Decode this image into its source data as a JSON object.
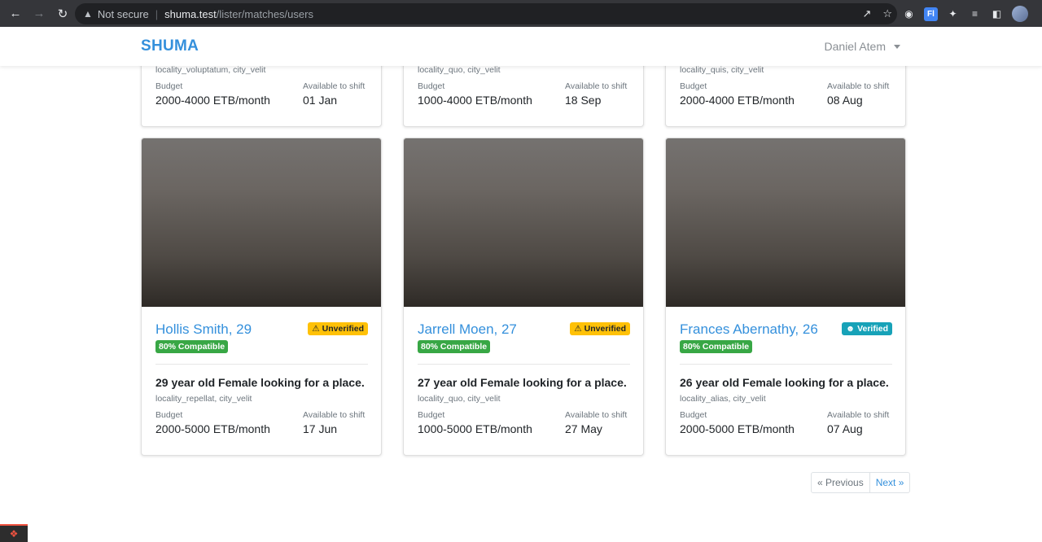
{
  "browser": {
    "security_label": "Not secure",
    "url_host": "shuma.test",
    "url_path": "/lister/matches/users"
  },
  "app": {
    "brand": "SHUMA",
    "user_name": "Daniel Atem"
  },
  "top_cards": [
    {
      "locality": "locality_voluptatum, city_velit",
      "budget_label": "Budget",
      "budget": "2000-4000 ETB/month",
      "shift_label": "Available to shift",
      "shift": "01 Jan"
    },
    {
      "locality": "locality_quo, city_velit",
      "budget_label": "Budget",
      "budget": "1000-4000 ETB/month",
      "shift_label": "Available to shift",
      "shift": "18 Sep"
    },
    {
      "locality": "locality_quis, city_velit",
      "budget_label": "Budget",
      "budget": "2000-4000 ETB/month",
      "shift_label": "Available to shift",
      "shift": "08 Aug"
    }
  ],
  "cards": [
    {
      "name": "Hollis Smith, 29",
      "status": "Unverified",
      "compat": "80% Compatible",
      "desc": "29 year old Female looking for a place.",
      "locality": "locality_repellat, city_velit",
      "budget_label": "Budget",
      "budget": "2000-5000 ETB/month",
      "shift_label": "Available to shift",
      "shift": "17 Jun"
    },
    {
      "name": "Jarrell Moen, 27",
      "status": "Unverified",
      "compat": "80% Compatible",
      "desc": "27 year old Female looking for a place.",
      "locality": "locality_quo, city_velit",
      "budget_label": "Budget",
      "budget": "1000-5000 ETB/month",
      "shift_label": "Available to shift",
      "shift": "27 May"
    },
    {
      "name": "Frances Abernathy, 26",
      "status": "Verified",
      "compat": "80% Compatible",
      "desc": "26 year old Female looking for a place.",
      "locality": "locality_alias, city_velit",
      "budget_label": "Budget",
      "budget": "2000-5000 ETB/month",
      "shift_label": "Available to shift",
      "shift": "07 Aug"
    }
  ],
  "pagination": {
    "previous": "« Previous",
    "next": "Next »"
  },
  "colors": {
    "brand": "#3490dc",
    "warning": "#ffc107",
    "info": "#17a2b8",
    "success": "#38a745"
  },
  "icons": {
    "warning": "warning-icon",
    "verified": "user-check-icon"
  }
}
